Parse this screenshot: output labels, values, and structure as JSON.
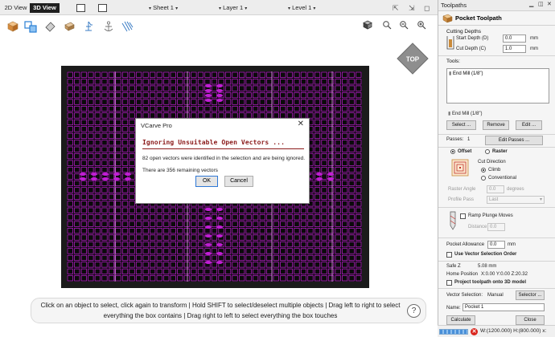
{
  "toolbar": {
    "tab_2d": "2D View",
    "tab_3d": "3D View",
    "sheet": "Sheet 1",
    "layer": "Layer 1",
    "level": "Level 1"
  },
  "dialog": {
    "title": "VCarve Pro",
    "close": "✕",
    "heading": "Ignoring Unsuitable Open Vectors ...",
    "message1": "82 open vectors were identified in the selection and are being ignored.",
    "message2": "There are 356 remaining vectors",
    "ok": "OK",
    "cancel": "Cancel"
  },
  "viewcube": {
    "label": "TOP"
  },
  "hint": {
    "line1": "Click on an object to select, click again to transform | Hold SHIFT to select/deselect multiple objects | Drag left to right to select",
    "line2": "everything the box contains | Drag right to left to select everything the box touches",
    "help": "?"
  },
  "panel": {
    "window_title": "Toolpaths",
    "heading": "Pocket Toolpath",
    "cutting_depths": "Cutting Depths",
    "start_depth_label": "Start Depth (D)",
    "start_depth_value": "0.0",
    "cut_depth_label": "Cut Depth (C)",
    "cut_depth_value": "1.0",
    "unit": "mm",
    "tools_label": "Tools:",
    "tool_list_item": "End Mill (1/8\")",
    "tool_below": "End Mill (1/8\")",
    "select_btn": "Select ...",
    "remove_btn": "Remove",
    "edit_btn": "Edit ...",
    "passes_label": "Passes:",
    "passes_value": "1",
    "edit_passes_btn": "Edit Passes ...",
    "offset_label": "Offset",
    "raster_label": "Raster",
    "cut_direction": "Cut Direction",
    "climb": "Climb",
    "conventional": "Conventional",
    "raster_angle_label": "Raster Angle",
    "raster_angle_value": "0.0",
    "degrees": "degrees",
    "profile_pass_label": "Profile Pass",
    "profile_pass_value": "Last",
    "ramp_label": "Ramp Plunge Moves",
    "distance_label": "Distance",
    "distance_value": "0.0",
    "pocket_allowance_label": "Pocket Allowance",
    "pocket_allowance_value": "0.0",
    "use_vector_order": "Use Vector Selection Order",
    "safe_z_label": "Safe Z",
    "safe_z_value": "5.08 mm",
    "home_position_label": "Home Position",
    "home_position_value": "X:0.00 Y:0.00 Z:20.32",
    "project_label": "Project toolpath onto 3D model",
    "vector_selection_label": "Vector Selection:",
    "vector_selection_value": "Manual",
    "selector_btn": "Selector ...",
    "name_label": "Name:",
    "name_value": "Pocket 1",
    "calculate_btn": "Calculate",
    "close_btn": "Close"
  },
  "status": {
    "error_icon": "✕",
    "text": "W:(1200.000) H:(800.000) x:"
  },
  "colors": {
    "vector_magenta": "#c21ed6",
    "dialog_heading": "#8b1a1a",
    "board": "#1b1b1b"
  }
}
